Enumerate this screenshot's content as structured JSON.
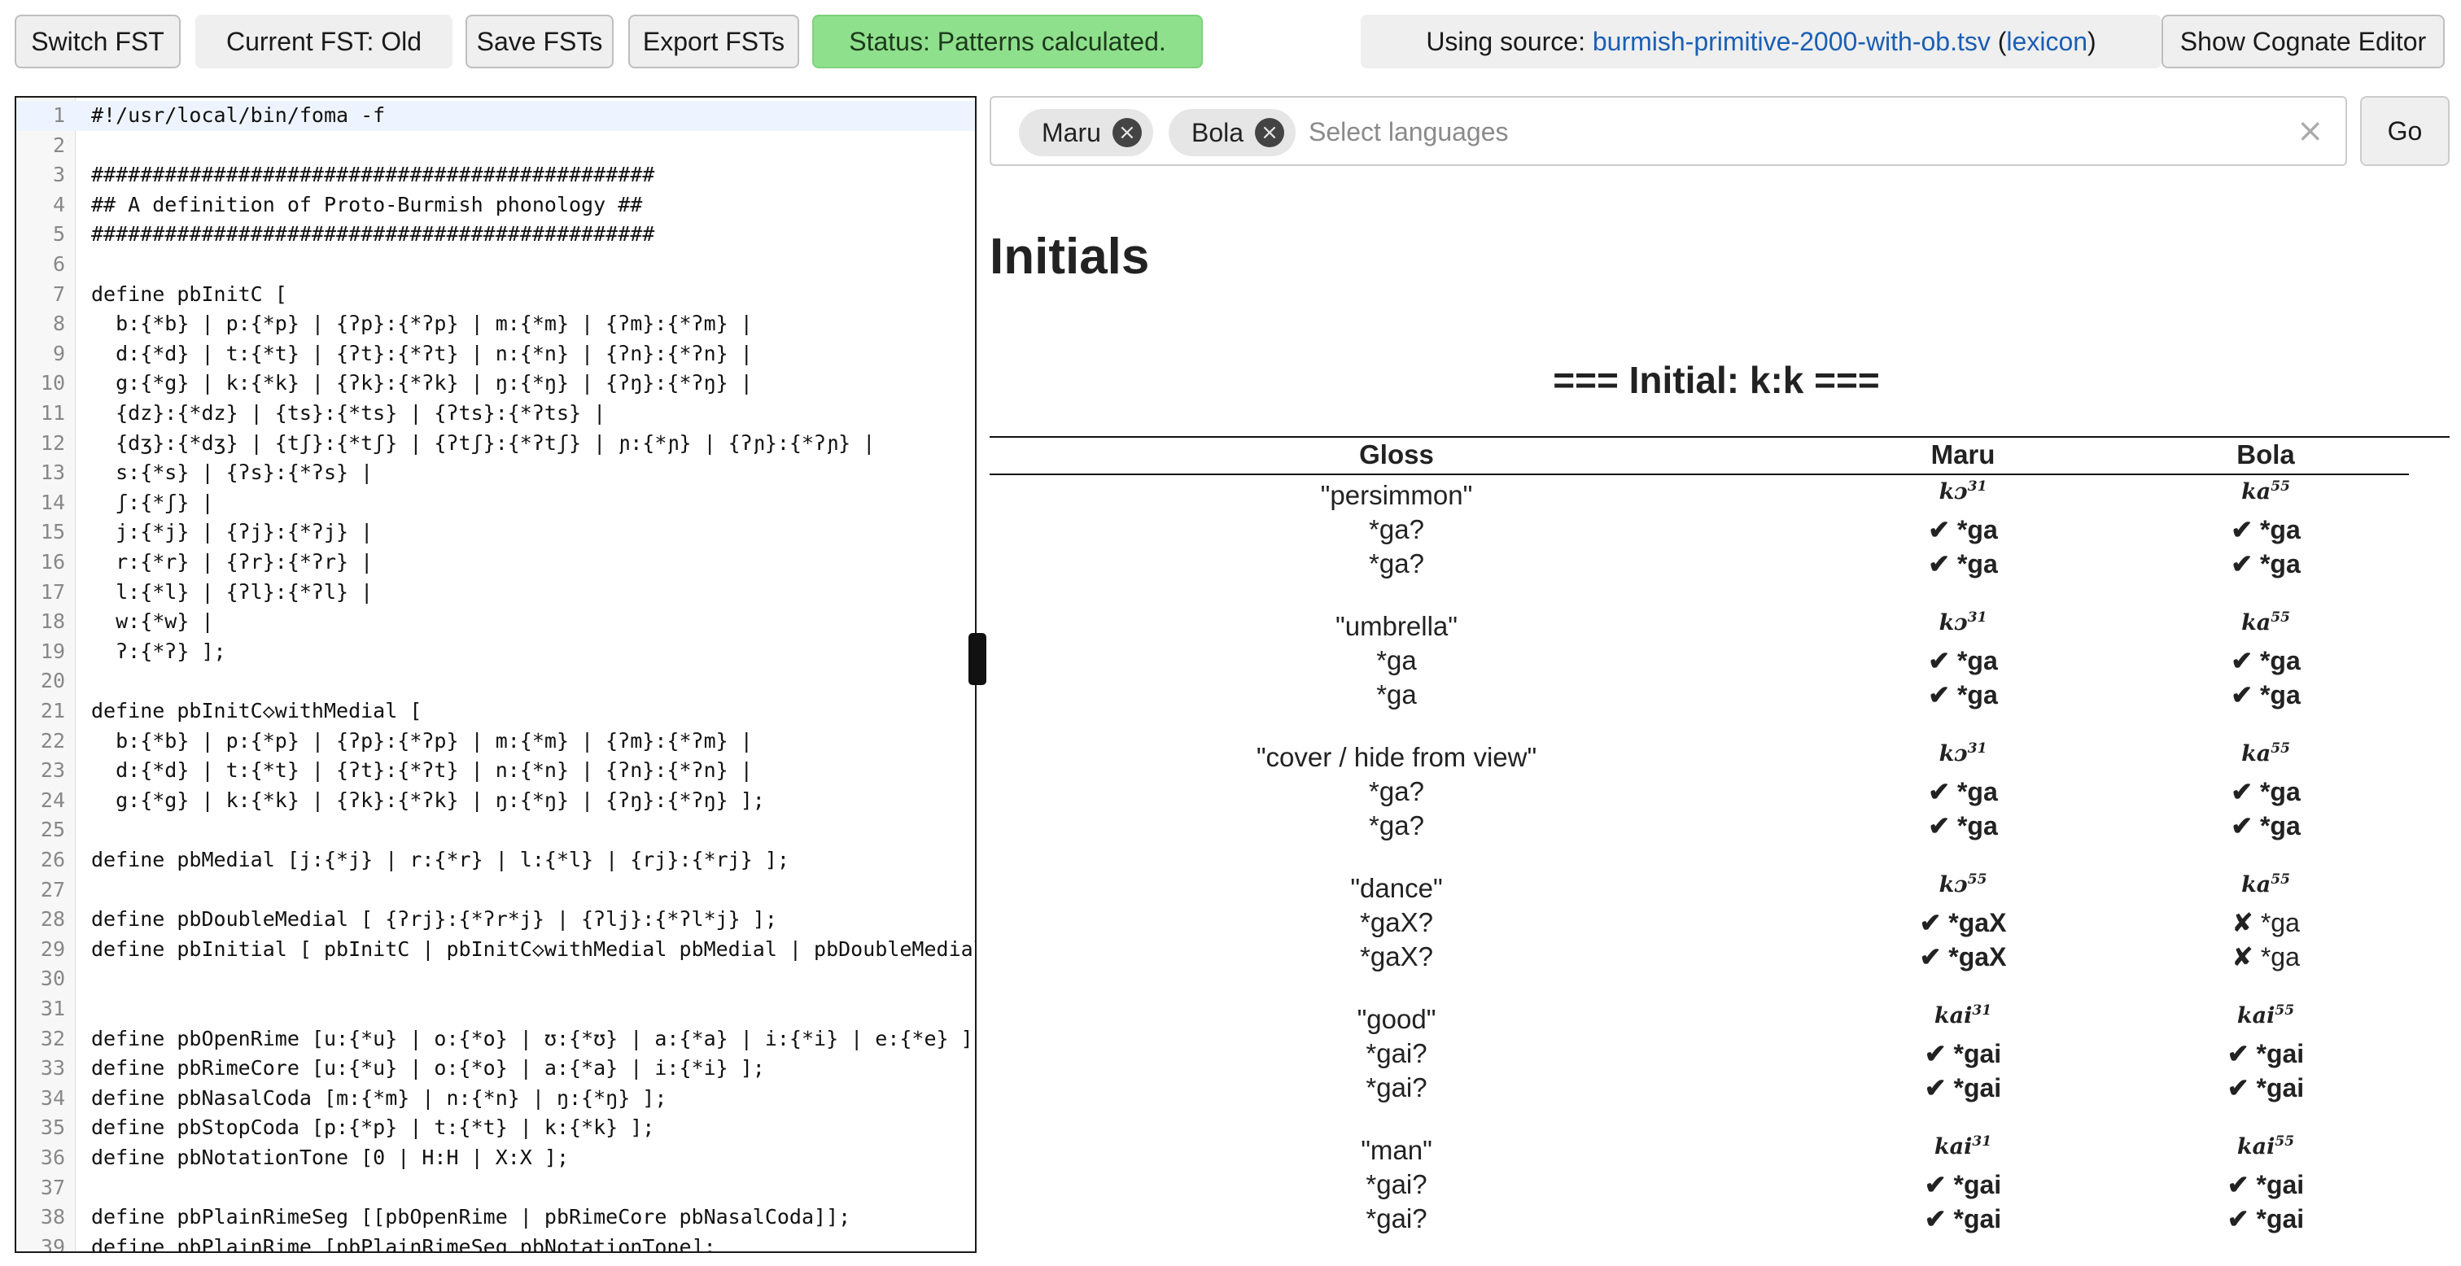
{
  "toolbar": {
    "switch_fst": "Switch FST",
    "current_fst": "Current FST: Old",
    "save_fsts": "Save FSTs",
    "export_fsts": "Export FSTs",
    "status": "Status: Patterns calculated.",
    "source_prefix": "Using source: ",
    "source_file": "burmish-primitive-2000-with-ob.tsv",
    "source_lexicon": "lexicon",
    "show_cognate_editor": "Show Cognate Editor",
    "status_color": "#8fe08c"
  },
  "editor": {
    "lines": [
      {
        "n": "1",
        "t": "#!/usr/local/bin/foma -f"
      },
      {
        "n": "2",
        "t": ""
      },
      {
        "n": "3",
        "t": "##############################################"
      },
      {
        "n": "4",
        "t": "## A definition of Proto-Burmish phonology ##"
      },
      {
        "n": "5",
        "t": "##############################################"
      },
      {
        "n": "6",
        "t": ""
      },
      {
        "n": "7",
        "t": "define pbInitC ["
      },
      {
        "n": "8",
        "t": "  b:{*b} | p:{*p} | {ʔp}:{*ʔp} | m:{*m} | {ʔm}:{*ʔm} |"
      },
      {
        "n": "9",
        "t": "  d:{*d} | t:{*t} | {ʔt}:{*ʔt} | n:{*n} | {ʔn}:{*ʔn} |"
      },
      {
        "n": "10",
        "t": "  g:{*g} | k:{*k} | {ʔk}:{*ʔk} | ŋ:{*ŋ} | {ʔŋ}:{*ʔŋ} |"
      },
      {
        "n": "11",
        "t": "  {dz}:{*dz} | {ts}:{*ts} | {ʔts}:{*ʔts} |"
      },
      {
        "n": "12",
        "t": "  {dʒ}:{*dʒ} | {tʃ}:{*tʃ} | {ʔtʃ}:{*ʔtʃ} | ɲ:{*ɲ} | {ʔɲ}:{*ʔɲ} |"
      },
      {
        "n": "13",
        "t": "  s:{*s} | {ʔs}:{*ʔs} |"
      },
      {
        "n": "14",
        "t": "  ʃ:{*ʃ} |"
      },
      {
        "n": "15",
        "t": "  j:{*j} | {ʔj}:{*ʔj} |"
      },
      {
        "n": "16",
        "t": "  r:{*r} | {ʔr}:{*ʔr} |"
      },
      {
        "n": "17",
        "t": "  l:{*l} | {ʔl}:{*ʔl} |"
      },
      {
        "n": "18",
        "t": "  w:{*w} |"
      },
      {
        "n": "19",
        "t": "  ʔ:{*ʔ} ];"
      },
      {
        "n": "20",
        "t": ""
      },
      {
        "n": "21",
        "t": "define pbInitC◇withMedial ["
      },
      {
        "n": "22",
        "t": "  b:{*b} | p:{*p} | {ʔp}:{*ʔp} | m:{*m} | {ʔm}:{*ʔm} |"
      },
      {
        "n": "23",
        "t": "  d:{*d} | t:{*t} | {ʔt}:{*ʔt} | n:{*n} | {ʔn}:{*ʔn} |"
      },
      {
        "n": "24",
        "t": "  g:{*g} | k:{*k} | {ʔk}:{*ʔk} | ŋ:{*ŋ} | {ʔŋ}:{*ʔŋ} ];"
      },
      {
        "n": "25",
        "t": ""
      },
      {
        "n": "26",
        "t": "define pbMedial [j:{*j} | r:{*r} | l:{*l} | {rj}:{*rj} ];"
      },
      {
        "n": "27",
        "t": ""
      },
      {
        "n": "28",
        "t": "define pbDoubleMedial [ {ʔrj}:{*ʔr*j} | {ʔlj}:{*ʔl*j} ];"
      },
      {
        "n": "29",
        "t": "define pbInitial [ pbInitC | pbInitC◇withMedial pbMedial | pbDoubleMedial ];"
      },
      {
        "n": "30",
        "t": ""
      },
      {
        "n": "31",
        "t": ""
      },
      {
        "n": "32",
        "t": "define pbOpenRime [u:{*u} | o:{*o} | ʊ:{*ʊ} | a:{*a} | i:{*i} | e:{*e} ];"
      },
      {
        "n": "33",
        "t": "define pbRimeCore [u:{*u} | o:{*o} | a:{*a} | i:{*i} ];"
      },
      {
        "n": "34",
        "t": "define pbNasalCoda [m:{*m} | n:{*n} | ŋ:{*ŋ} ];"
      },
      {
        "n": "35",
        "t": "define pbStopCoda [p:{*p} | t:{*t} | k:{*k} ];"
      },
      {
        "n": "36",
        "t": "define pbNotationTone [0 | H:H | X:X ];"
      },
      {
        "n": "37",
        "t": ""
      },
      {
        "n": "38",
        "t": "define pbPlainRimeSeg [[pbOpenRime | pbRimeCore pbNasalCoda]];"
      },
      {
        "n": "39",
        "t": "define pbPlainRime [pbPlainRimeSeg pbNotationTone];"
      }
    ]
  },
  "language_select": {
    "chips": [
      "Maru",
      "Bola"
    ],
    "placeholder": "Select languages",
    "clear_symbol": "×",
    "chip_remove_symbol": "×",
    "go_label": "Go"
  },
  "results": {
    "section_title": "Initials",
    "group_title": "=== Initial: k:k ===",
    "columns": [
      "Gloss",
      "Maru",
      "Bola"
    ],
    "check_mark": "✔",
    "cross_mark": "✘",
    "entries": [
      {
        "gloss": "\"persimmon\"",
        "maru": {
          "form": "kɔ",
          "tone": "31"
        },
        "bola": {
          "form": "ka",
          "tone": "55"
        },
        "rows": [
          {
            "proto": "*ga?",
            "maru": {
              "ok": true,
              "v": "*ga"
            },
            "bola": {
              "ok": true,
              "v": "*ga"
            }
          },
          {
            "proto": "*ga?",
            "maru": {
              "ok": true,
              "v": "*ga"
            },
            "bola": {
              "ok": true,
              "v": "*ga"
            }
          }
        ]
      },
      {
        "gloss": "\"umbrella\"",
        "maru": {
          "form": "kɔ",
          "tone": "31"
        },
        "bola": {
          "form": "ka",
          "tone": "55"
        },
        "rows": [
          {
            "proto": "*ga",
            "maru": {
              "ok": true,
              "v": "*ga"
            },
            "bola": {
              "ok": true,
              "v": "*ga"
            }
          },
          {
            "proto": "*ga",
            "maru": {
              "ok": true,
              "v": "*ga"
            },
            "bola": {
              "ok": true,
              "v": "*ga"
            }
          }
        ]
      },
      {
        "gloss": "\"cover / hide from view\"",
        "maru": {
          "form": "kɔ",
          "tone": "31"
        },
        "bola": {
          "form": "ka",
          "tone": "55"
        },
        "rows": [
          {
            "proto": "*ga?",
            "maru": {
              "ok": true,
              "v": "*ga"
            },
            "bola": {
              "ok": true,
              "v": "*ga"
            }
          },
          {
            "proto": "*ga?",
            "maru": {
              "ok": true,
              "v": "*ga"
            },
            "bola": {
              "ok": true,
              "v": "*ga"
            }
          }
        ]
      },
      {
        "gloss": "\"dance\"",
        "maru": {
          "form": "kɔ",
          "tone": "55"
        },
        "bola": {
          "form": "ka",
          "tone": "55"
        },
        "rows": [
          {
            "proto": "*gaX?",
            "maru": {
              "ok": true,
              "v": "*gaX"
            },
            "bola": {
              "ok": false,
              "v": "*ga"
            }
          },
          {
            "proto": "*gaX?",
            "maru": {
              "ok": true,
              "v": "*gaX"
            },
            "bola": {
              "ok": false,
              "v": "*ga"
            }
          }
        ]
      },
      {
        "gloss": "\"good\"",
        "maru": {
          "form": "kai",
          "tone": "31"
        },
        "bola": {
          "form": "kai",
          "tone": "55"
        },
        "rows": [
          {
            "proto": "*gai?",
            "maru": {
              "ok": true,
              "v": "*gai"
            },
            "bola": {
              "ok": true,
              "v": "*gai"
            }
          },
          {
            "proto": "*gai?",
            "maru": {
              "ok": true,
              "v": "*gai"
            },
            "bola": {
              "ok": true,
              "v": "*gai"
            }
          }
        ]
      },
      {
        "gloss": "\"man\"",
        "maru": {
          "form": "kai",
          "tone": "31"
        },
        "bola": {
          "form": "kai",
          "tone": "55"
        },
        "rows": [
          {
            "proto": "*gai?",
            "maru": {
              "ok": true,
              "v": "*gai"
            },
            "bola": {
              "ok": true,
              "v": "*gai"
            }
          },
          {
            "proto": "*gai?",
            "maru": {
              "ok": true,
              "v": "*gai"
            },
            "bola": {
              "ok": true,
              "v": "*gai"
            }
          }
        ]
      }
    ]
  }
}
